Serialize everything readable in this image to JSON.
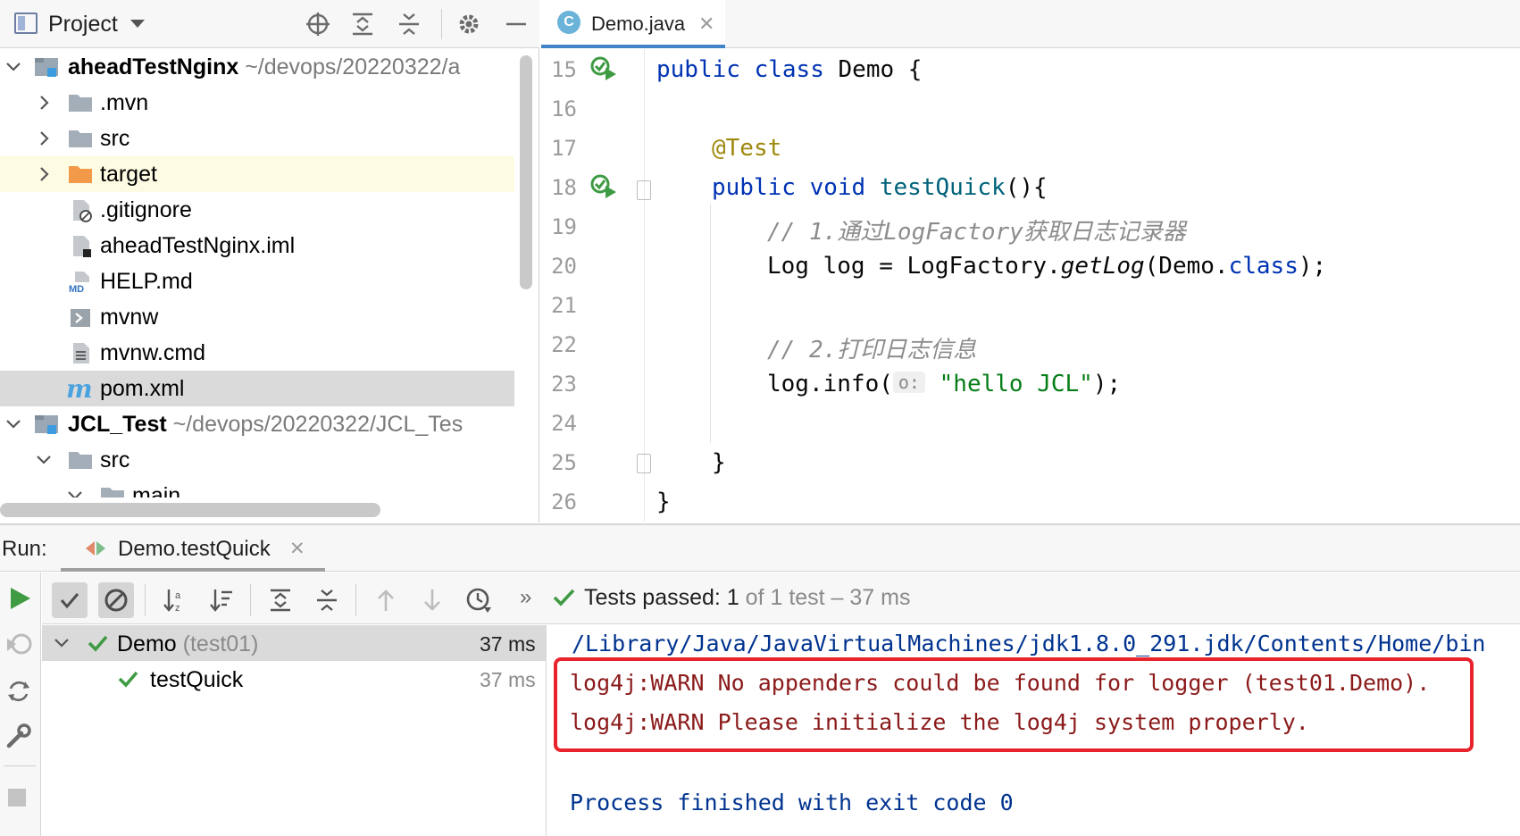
{
  "project_panel": {
    "title": "Project",
    "tree": [
      {
        "label": "aheadTestNginx",
        "path": "~/devops/20220322/a",
        "bold": true,
        "icon": "module-icon"
      },
      {
        "label": ".mvn",
        "icon": "folder-icon"
      },
      {
        "label": "src",
        "icon": "folder-icon"
      },
      {
        "label": "target",
        "icon": "folder-orange-icon"
      },
      {
        "label": ".gitignore",
        "icon": "gitignore-file-icon"
      },
      {
        "label": "aheadTestNginx.iml",
        "icon": "iml-file-icon"
      },
      {
        "label": "HELP.md",
        "icon": "markdown-file-icon"
      },
      {
        "label": "mvnw",
        "icon": "shell-file-icon"
      },
      {
        "label": "mvnw.cmd",
        "icon": "text-file-icon"
      },
      {
        "label": "pom.xml",
        "icon": "maven-file-icon"
      },
      {
        "label": "JCL_Test",
        "path": "~/devops/20220322/JCL_Tes",
        "bold": true,
        "icon": "module-icon"
      },
      {
        "label": "src",
        "icon": "folder-icon"
      },
      {
        "label": "main",
        "icon": "folder-icon"
      }
    ]
  },
  "editor": {
    "tab_label": "Demo.java",
    "line_numbers": [
      "15",
      "16",
      "17",
      "18",
      "19",
      "20",
      "21",
      "22",
      "23",
      "24",
      "25",
      "26"
    ],
    "code": {
      "l15_kw1": "public",
      "l15_kw2": "class",
      "l15_rest": "Demo {",
      "l17_ann": "@Test",
      "l18_kw1": "public",
      "l18_kw2": "void",
      "l18_fn": "testQuick",
      "l18_rest": "(){",
      "l19_cmt": "// 1.通过LogFactory获取日志记录器",
      "l20_a": "Log log = LogFactory.",
      "l20_it": "getLog",
      "l20_b": "(Demo.",
      "l20_cls": "class",
      "l20_c": ");",
      "l22_cmt": "// 2.打印日志信息",
      "l23_a": "log.info(",
      "l23_hint": "o:",
      "l23_str": "\"hello JCL\"",
      "l23_b": ");",
      "l25": "}",
      "l26": "}"
    }
  },
  "run": {
    "label": "Run:",
    "tab_label": "Demo.testQuick",
    "status_prefix": "Tests passed:",
    "status_count": "1",
    "status_rest": "of 1 test – 37 ms",
    "tree": [
      {
        "name": "Demo",
        "pkg": "(test01)",
        "time": "37 ms"
      },
      {
        "name": "testQuick",
        "time": "37 ms"
      }
    ],
    "console": [
      "/Library/Java/JavaVirtualMachines/jdk1.8.0_291.jdk/Contents/Home/bin",
      "log4j:WARN No appenders could be found for logger (test01.Demo).",
      "log4j:WARN Please initialize the log4j system properly.",
      "Process finished with exit code 0"
    ]
  },
  "colors": {
    "accent": "#4083c9",
    "warn_text": "#8b1a1a",
    "highlight_box": "#e8232b",
    "pass_green": "#3e9b43",
    "console_blue": "#00338f"
  }
}
